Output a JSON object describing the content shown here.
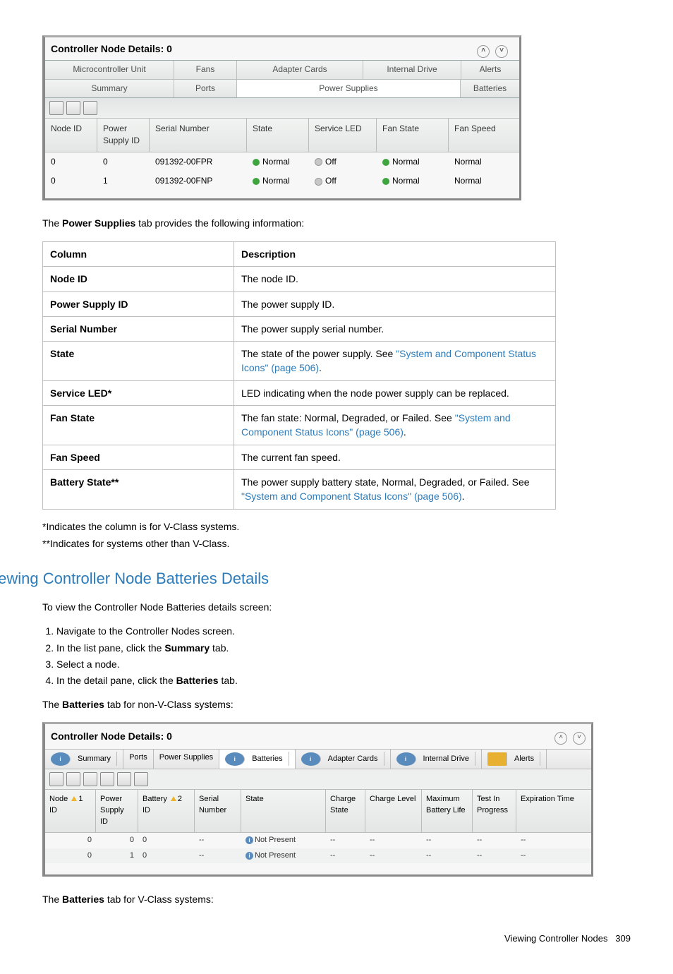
{
  "panel1": {
    "title": "Controller Node Details: 0",
    "tabs_row1": [
      "Microcontroller Unit",
      "Fans",
      "Adapter Cards",
      "Internal Drive",
      "Alerts"
    ],
    "tabs_row2": [
      "Summary",
      "Ports",
      "Power Supplies",
      "Batteries"
    ],
    "columns": [
      "Node ID",
      "Power Supply ID",
      "Serial Number",
      "State",
      "Service LED",
      "Fan State",
      "Fan Speed"
    ],
    "rows": [
      {
        "node": "0",
        "ps": "0",
        "serial": "091392-00FPR",
        "state": "Normal",
        "led": "Off",
        "fanstate": "Normal",
        "fanspeed": "Normal"
      },
      {
        "node": "0",
        "ps": "1",
        "serial": "091392-00FNP",
        "state": "Normal",
        "led": "Off",
        "fanstate": "Normal",
        "fanspeed": "Normal"
      }
    ]
  },
  "intro": "The Power Supplies tab provides the following information:",
  "intro_bold": "Power Supplies",
  "doc_table": {
    "headers": [
      "Column",
      "Description"
    ],
    "rows": [
      {
        "c": "Node ID",
        "d": "The node ID."
      },
      {
        "c": "Power Supply ID",
        "d": "The power supply ID."
      },
      {
        "c": "Serial Number",
        "d": "The power supply serial number."
      },
      {
        "c": "State",
        "d_pre": "The state of the power supply. See ",
        "d_link": "\"System and Component Status Icons\" (page 506)",
        "d_post": "."
      },
      {
        "c": "Service LED*",
        "d": "LED indicating when the node power supply can be replaced."
      },
      {
        "c": "Fan State",
        "d_pre": "The fan state: Normal, Degraded, or Failed. See ",
        "d_link": "\"System and Component Status Icons\" (page 506)",
        "d_post": "."
      },
      {
        "c": "Fan Speed",
        "d": "The current fan speed."
      },
      {
        "c": "Battery State**",
        "d_pre": "The power supply battery state, Normal, Degraded, or Failed. See ",
        "d_link": "\"System and Component Status Icons\" (page 506)",
        "d_post": "."
      }
    ]
  },
  "note1": "*Indicates the column is for V-Class systems.",
  "note2": "**Indicates for systems other than V-Class.",
  "section_heading": "Viewing Controller Node Batteries Details",
  "section_intro": "To view the Controller Node Batteries details screen:",
  "steps": [
    "Navigate to the Controller Nodes screen.",
    {
      "pre": "In the list pane, click the ",
      "b": "Summary",
      "post": " tab."
    },
    "Select a node.",
    {
      "pre": "In the detail pane, click the ",
      "b": "Batteries",
      "post": " tab."
    }
  ],
  "batt_intro_pre": "The ",
  "batt_intro_b": "Batteries",
  "batt_intro_post": " tab for non-V-Class systems:",
  "panel2": {
    "title": "Controller Node Details: 0",
    "tabs": [
      "Summary",
      "Ports",
      "Power Supplies",
      "Batteries",
      "Adapter Cards",
      "Internal Drive",
      "Alerts"
    ],
    "columns": [
      "Node ID",
      "Power Supply ID",
      "Battery ID",
      "Serial Number",
      "State",
      "Charge State",
      "Charge Level",
      "Maximum Battery Life",
      "Test In Progress",
      "Expiration Time"
    ],
    "sort1": "1",
    "sort2": "2",
    "rows": [
      {
        "n": "0",
        "ps": "0",
        "b": "0",
        "ser": "--",
        "state": "Not Present",
        "cs": "--",
        "cl": "--",
        "ml": "--",
        "tp": "--",
        "et": "--"
      },
      {
        "n": "0",
        "ps": "1",
        "b": "0",
        "ser": "--",
        "state": "Not Present",
        "cs": "--",
        "cl": "--",
        "ml": "--",
        "tp": "--",
        "et": "--"
      }
    ]
  },
  "vclass_intro_pre": "The ",
  "vclass_intro_b": "Batteries",
  "vclass_intro_post": " tab for V-Class systems:",
  "footer_text": "Viewing Controller Nodes",
  "footer_page": "309"
}
